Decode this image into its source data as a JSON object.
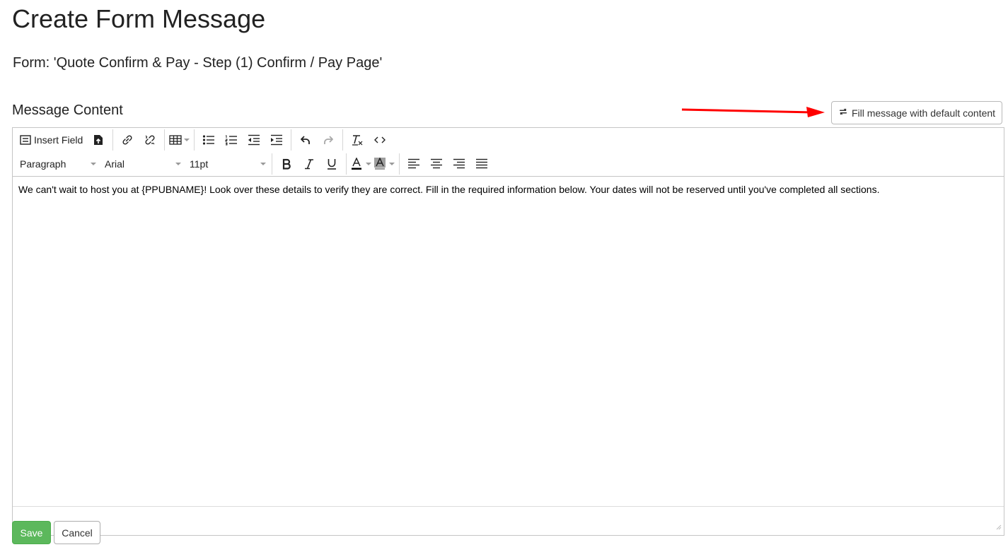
{
  "page": {
    "title": "Create Form Message",
    "form_name": "Form: 'Quote Confirm & Pay - Step (1) Confirm / Pay Page'",
    "section_title": "Message Content"
  },
  "fill_button": {
    "label": "Fill message with default content",
    "icon": "refresh-icon"
  },
  "annotation": {
    "arrow_color": "#ff0000"
  },
  "toolbar": {
    "insert_field_label": "Insert Field",
    "block_format": "Paragraph",
    "font_family": "Arial",
    "font_size": "11pt",
    "buttons_row1": [
      "insert-field",
      "insert-file",
      "link",
      "unlink",
      "table",
      "bullet-list",
      "numbered-list",
      "outdent",
      "indent",
      "undo",
      "redo",
      "clear-formatting",
      "source-code"
    ],
    "buttons_row2": [
      "bold",
      "italic",
      "underline",
      "text-color",
      "background-color",
      "align-left",
      "align-center",
      "align-right",
      "justify"
    ]
  },
  "editor": {
    "content": "We can't wait to host you at {PPUBNAME}! Look over these details to verify they are correct. Fill in the required information below. Your dates will not be reserved until you've completed all sections."
  },
  "actions": {
    "save_label": "Save",
    "cancel_label": "Cancel"
  },
  "colors": {
    "save_bg": "#5cb85c",
    "text_color_underline": "#000000",
    "background_color_swatch": "#9e9e9e"
  }
}
